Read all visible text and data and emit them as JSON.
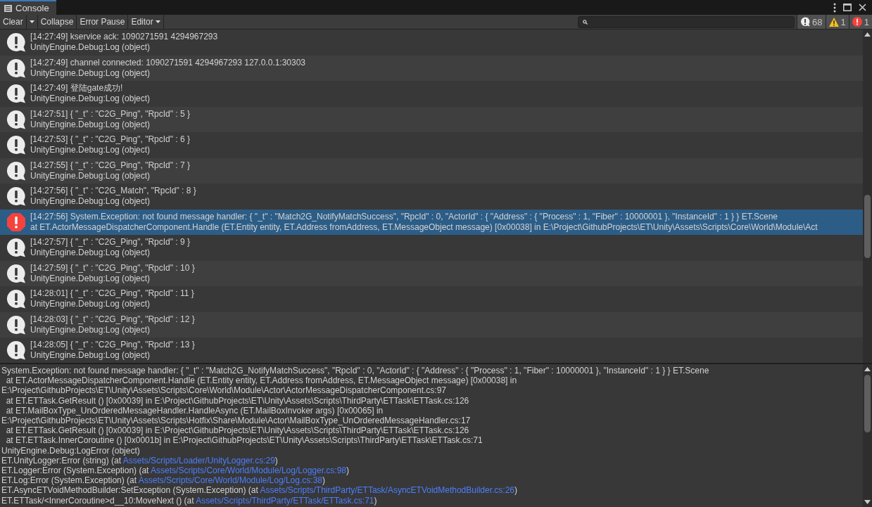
{
  "window": {
    "title": "Console"
  },
  "toolbar": {
    "buttons": [
      {
        "label": "Clear",
        "kind": "plain"
      },
      {
        "label": "Collapse",
        "kind": "plain"
      },
      {
        "label": "Error Pause",
        "kind": "plain"
      },
      {
        "label": "Editor",
        "kind": "dropdown"
      }
    ],
    "counters": [
      {
        "kind": "log",
        "count": "68"
      },
      {
        "kind": "warning",
        "count": "1"
      },
      {
        "kind": "error",
        "count": "1"
      }
    ]
  },
  "entries": [
    {
      "kind": "log",
      "selected": false,
      "message": "[14:27:49] kservice ack: 1090271591 4294967293",
      "source": "UnityEngine.Debug:Log (object)"
    },
    {
      "kind": "log",
      "selected": false,
      "message": "[14:27:49] channel connected: 1090271591 4294967293 127.0.0.1:30303",
      "source": "UnityEngine.Debug:Log (object)"
    },
    {
      "kind": "log",
      "selected": false,
      "message": "[14:27:49] 登陆gate成功!",
      "source": "UnityEngine.Debug:Log (object)"
    },
    {
      "kind": "log",
      "selected": false,
      "message": "[14:27:51] { \"_t\" : \"C2G_Ping\", \"RpcId\" : 5 }",
      "source": "UnityEngine.Debug:Log (object)"
    },
    {
      "kind": "log",
      "selected": false,
      "message": "[14:27:53] { \"_t\" : \"C2G_Ping\", \"RpcId\" : 6 }",
      "source": "UnityEngine.Debug:Log (object)"
    },
    {
      "kind": "log",
      "selected": false,
      "message": "[14:27:55] { \"_t\" : \"C2G_Ping\", \"RpcId\" : 7 }",
      "source": "UnityEngine.Debug:Log (object)"
    },
    {
      "kind": "log",
      "selected": false,
      "message": "[14:27:56] { \"_t\" : \"C2G_Match\", \"RpcId\" : 8 }",
      "source": "UnityEngine.Debug:Log (object)"
    },
    {
      "kind": "error",
      "selected": true,
      "message": "[14:27:56] System.Exception: not found message handler: { \"_t\" : \"Match2G_NotifyMatchSuccess\", \"RpcId\" : 0, \"ActorId\" : { \"Address\" : { \"Process\" : 1, \"Fiber\" : 10000001 }, \"InstanceId\" : 1 } } ET.Scene",
      "source": " at ET.ActorMessageDispatcherComponent.Handle (ET.Entity entity, ET.Address fromAddress, ET.MessageObject message) [0x00038] in E:\\Project\\GithubProjects\\ET\\Unity\\Assets\\Scripts\\Core\\World\\Module\\Act"
    },
    {
      "kind": "log",
      "selected": false,
      "message": "[14:27:57] { \"_t\" : \"C2G_Ping\", \"RpcId\" : 9 }",
      "source": "UnityEngine.Debug:Log (object)"
    },
    {
      "kind": "log",
      "selected": false,
      "message": "[14:27:59] { \"_t\" : \"C2G_Ping\", \"RpcId\" : 10 }",
      "source": "UnityEngine.Debug:Log (object)"
    },
    {
      "kind": "log",
      "selected": false,
      "message": "[14:28:01] { \"_t\" : \"C2G_Ping\", \"RpcId\" : 11 }",
      "source": "UnityEngine.Debug:Log (object)"
    },
    {
      "kind": "log",
      "selected": false,
      "message": "[14:28:03] { \"_t\" : \"C2G_Ping\", \"RpcId\" : 12 }",
      "source": "UnityEngine.Debug:Log (object)"
    },
    {
      "kind": "log",
      "selected": false,
      "message": "[14:28:05] { \"_t\" : \"C2G_Ping\", \"RpcId\" : 13 }",
      "source": "UnityEngine.Debug:Log (object)"
    }
  ],
  "details": [
    {
      "text": "System.Exception: not found message handler: { \"_t\" : \"Match2G_NotifyMatchSuccess\", \"RpcId\" : 0, \"ActorId\" : { \"Address\" : { \"Process\" : 1, \"Fiber\" : 10000001 }, \"InstanceId\" : 1 } } ET.Scene"
    },
    {
      "text": "  at ET.ActorMessageDispatcherComponent.Handle (ET.Entity entity, ET.Address fromAddress, ET.MessageObject message) [0x00038] in"
    },
    {
      "text": "E:\\Project\\GithubProjects\\ET\\Unity\\Assets\\Scripts\\Core\\World\\Module\\Actor\\ActorMessageDispatcherComponent.cs:97"
    },
    {
      "text": "  at ET.ETTask.GetResult () [0x00039] in E:\\Project\\GithubProjects\\ET\\Unity\\Assets\\Scripts\\ThirdParty\\ETTask\\ETTask.cs:126"
    },
    {
      "text": "  at ET.MailBoxType_UnOrderedMessageHandler.HandleAsync (ET.MailBoxInvoker args) [0x00065] in"
    },
    {
      "text": "E:\\Project\\GithubProjects\\ET\\Unity\\Assets\\Scripts\\Hotfix\\Share\\Module\\Actor\\MailBoxType_UnOrderedMessageHandler.cs:17"
    },
    {
      "text": "  at ET.ETTask.GetResult () [0x00039] in E:\\Project\\GithubProjects\\ET\\Unity\\Assets\\Scripts\\ThirdParty\\ETTask\\ETTask.cs:126"
    },
    {
      "text": "  at ET.ETTask.InnerCoroutine () [0x0001b] in E:\\Project\\GithubProjects\\ET\\Unity\\Assets\\Scripts\\ThirdParty\\ETTask\\ETTask.cs:71"
    },
    {
      "text": "UnityEngine.Debug:LogError (object)"
    },
    {
      "text": "ET.UnityLogger:Error (string) (at ",
      "link": "Assets/Scripts/Loader/UnityLogger.cs:29",
      "after": ")"
    },
    {
      "text": "ET.Logger:Error (System.Exception) (at ",
      "link": "Assets/Scripts/Core/World/Module/Log/Logger.cs:98",
      "after": ")"
    },
    {
      "text": "ET.Log:Error (System.Exception) (at ",
      "link": "Assets/Scripts/Core/World/Module/Log/Log.cs:38",
      "after": ")"
    },
    {
      "text": "ET.AsyncETVoidMethodBuilder:SetException (System.Exception) (at ",
      "link": "Assets/Scripts/ThirdParty/ETTask/AsyncETVoidMethodBuilder.cs:26",
      "after": ")"
    },
    {
      "text": "ET.ETTask/<InnerCoroutine>d__10:MoveNext () (at ",
      "link": "Assets/Scripts/ThirdParty/ETTask/ETTask.cs:71",
      "after": ")"
    }
  ]
}
